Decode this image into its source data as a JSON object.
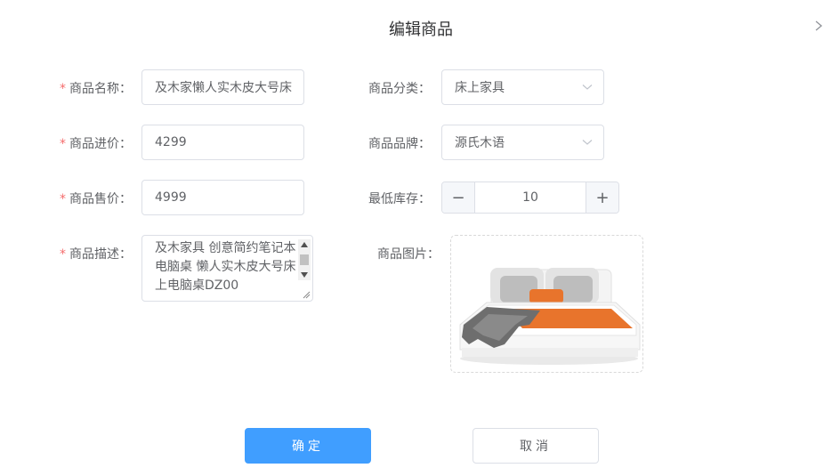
{
  "dialog": {
    "title": "编辑商品",
    "next_icon": "chevron-right-icon"
  },
  "form": {
    "required_mark": "*",
    "name": {
      "label": "商品名称：",
      "value": "及木家懒人实木皮大号床"
    },
    "category": {
      "label": "商品分类：",
      "value": "床上家具"
    },
    "cost_price": {
      "label": "商品进价：",
      "value": "4299"
    },
    "brand": {
      "label": "商品品牌：",
      "value": "源氏木语"
    },
    "sale_price": {
      "label": "商品售价：",
      "value": "4999"
    },
    "min_stock": {
      "label": "最低库存：",
      "value": "10",
      "minus": "−",
      "plus": "+"
    },
    "description": {
      "label": "商品描述：",
      "value": "及木家具 创意简约笔记本电脑桌 懒人实木皮大号床上电脑桌DZ00"
    },
    "image": {
      "label": "商品图片：",
      "alt": "bed-product-image"
    }
  },
  "actions": {
    "confirm": "确定",
    "cancel": "取消"
  },
  "colors": {
    "primary": "#409eff",
    "required": "#f56c6c",
    "border": "#dcdfe6",
    "accent_orange": "#e8742c"
  }
}
